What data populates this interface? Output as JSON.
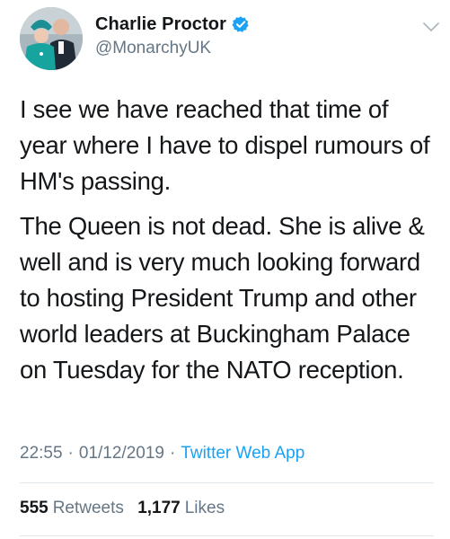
{
  "author": {
    "display_name": "Charlie Proctor",
    "handle": "@MonarchyUK",
    "verified": true,
    "verified_icon": "verified-badge-icon",
    "avatar_icon": "profile-avatar"
  },
  "tweet": {
    "paragraphs": [
      "I see we have reached that time of year where I have to dispel rumours of HM's passing.",
      "The Queen is not dead. She is alive & well and is very much looking forward to hosting President Trump and other world leaders at Buckingham Palace on Tuesday for the NATO reception."
    ],
    "time": "22:55",
    "separator": "·",
    "date": "01/12/2019",
    "source": "Twitter Web App"
  },
  "stats": {
    "retweets_count": "555",
    "retweets_label": "Retweets",
    "likes_count": "1,177",
    "likes_label": "Likes"
  },
  "colors": {
    "text": "#14171a",
    "secondary": "#657786",
    "link": "#1da1f2",
    "divider": "#e1e8ed"
  }
}
